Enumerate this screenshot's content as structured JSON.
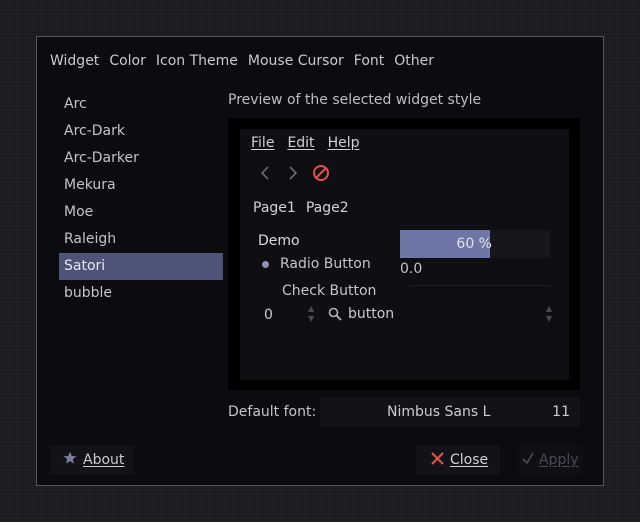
{
  "tabs": [
    "Widget",
    "Color",
    "Icon Theme",
    "Mouse Cursor",
    "Font",
    "Other"
  ],
  "theme_list": {
    "items": [
      "Arc",
      "Arc-Dark",
      "Arc-Darker",
      "Mekura",
      "Moe",
      "Raleigh",
      "Satori",
      "bubble"
    ],
    "selected": "Satori"
  },
  "preview": {
    "label": "Preview of the selected widget style",
    "menu": [
      "File",
      "Edit",
      "Help"
    ],
    "toolbar_icons": [
      "back-icon",
      "forward-icon",
      "stop-icon"
    ],
    "page_tabs": [
      "Page1",
      "Page2"
    ],
    "demo_label": "Demo",
    "radio_label": "Radio Button",
    "check_label": "Check Button",
    "progress": {
      "value": 0.6,
      "text": "60 %"
    },
    "scale_value": "0.0",
    "spin_value": "0",
    "combo_text": "button"
  },
  "default_font": {
    "label": "Default font:",
    "name": "Nimbus Sans L",
    "size": "11"
  },
  "buttons": {
    "about": "About",
    "close": "Close",
    "apply": "Apply"
  },
  "colors": {
    "accent": "#4d5478",
    "progress_fill": "#6e76a6",
    "close_icon": "#e0524a",
    "stop_icon": "#e0524a"
  }
}
